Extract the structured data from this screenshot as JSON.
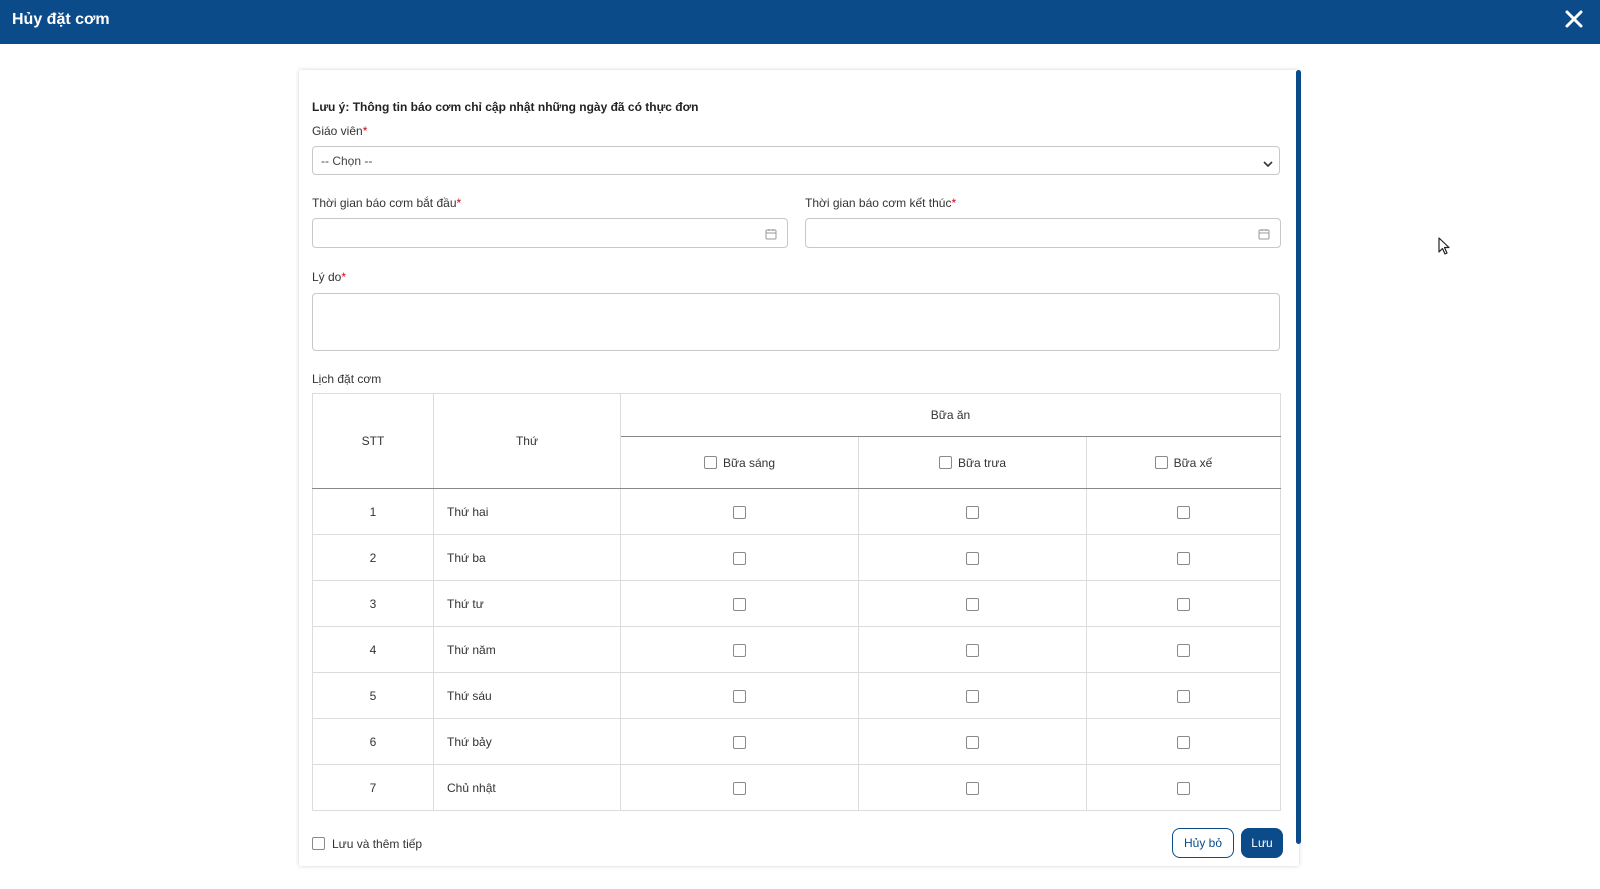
{
  "header": {
    "title": "Hủy đặt cơm",
    "close_icon": "close-icon"
  },
  "form": {
    "note": "Lưu ý: Thông tin báo cơm chỉ cập nhật những ngày đã có thực đơn",
    "teacher": {
      "label": "Giáo viên",
      "required_mark": "*",
      "value": "-- Chọn --"
    },
    "start_date": {
      "label": "Thời gian báo cơm bắt đầu",
      "required_mark": "*",
      "value": ""
    },
    "end_date": {
      "label": "Thời gian báo cơm kết thúc",
      "required_mark": "*",
      "value": ""
    },
    "reason": {
      "label": "Lý do",
      "required_mark": "*",
      "value": ""
    }
  },
  "schedule": {
    "label": "Lịch đặt cơm",
    "columns": {
      "stt": "STT",
      "day": "Thứ",
      "meals": "Bữa ăn"
    },
    "meals": [
      "Bữa sáng",
      "Bữa trưa",
      "Bữa xế"
    ],
    "rows": [
      {
        "stt": "1",
        "day": "Thứ hai"
      },
      {
        "stt": "2",
        "day": "Thứ ba"
      },
      {
        "stt": "3",
        "day": "Thứ tư"
      },
      {
        "stt": "4",
        "day": "Thứ năm"
      },
      {
        "stt": "5",
        "day": "Thứ sáu"
      },
      {
        "stt": "6",
        "day": "Thứ bảy"
      },
      {
        "stt": "7",
        "day": "Chủ nhật"
      }
    ]
  },
  "footer": {
    "save_and_continue": "Lưu và thêm tiếp",
    "cancel_label": "Hủy bỏ",
    "save_label": "Lưu"
  },
  "colors": {
    "primary": "#0b4b8a",
    "required": "#d0021b"
  }
}
